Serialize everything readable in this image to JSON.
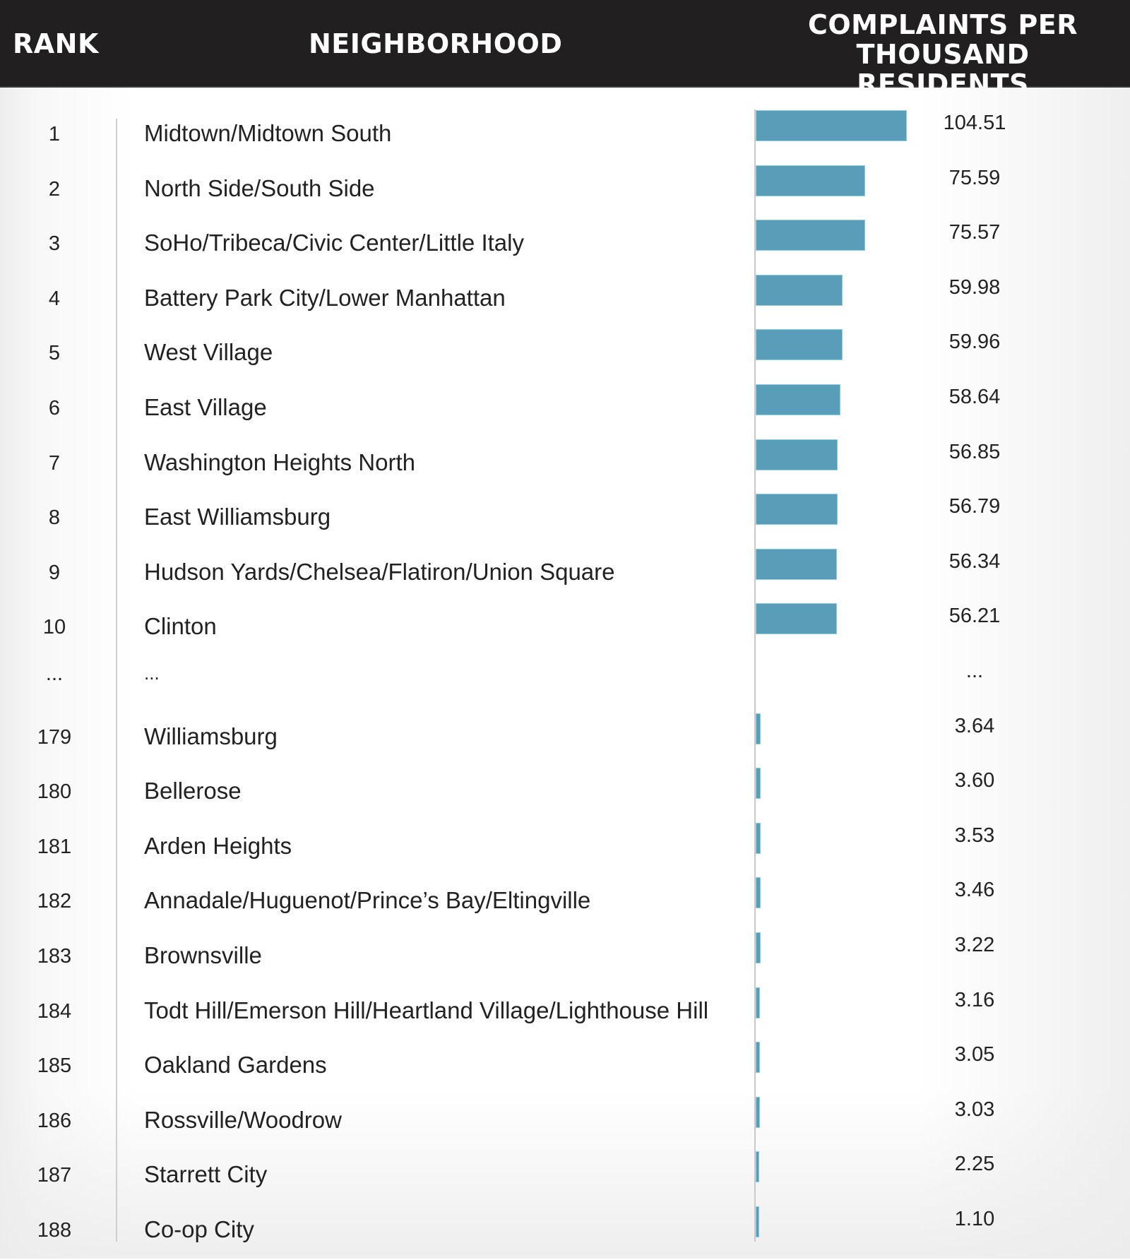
{
  "header": {
    "rank_label": "RANK",
    "neighborhood_label": "NEIGHBORHOOD",
    "metric_label_line1": "COMPLAINTS PER",
    "metric_label_line2": "THOUSAND RESIDENTS"
  },
  "colors": {
    "header_bg": "#221f20",
    "bar": "#5a9db9",
    "text": "#222222"
  },
  "chart_data": {
    "type": "bar",
    "orientation": "horizontal",
    "title": "",
    "xlabel": "Complaints per thousand residents",
    "ylabel": "Neighborhood",
    "xlim": [
      0,
      104.51
    ],
    "grid": false,
    "legend": "none",
    "rows": [
      {
        "rank": "1",
        "neighborhood": "Midtown/Midtown South",
        "value": 104.51,
        "label": "104.51"
      },
      {
        "rank": "2",
        "neighborhood": "North Side/South Side",
        "value": 75.59,
        "label": "75.59"
      },
      {
        "rank": "3",
        "neighborhood": "SoHo/Tribeca/Civic Center/Little Italy",
        "value": 75.57,
        "label": "75.57"
      },
      {
        "rank": "4",
        "neighborhood": "Battery Park City/Lower Manhattan",
        "value": 59.98,
        "label": "59.98"
      },
      {
        "rank": "5",
        "neighborhood": "West Village",
        "value": 59.96,
        "label": "59.96"
      },
      {
        "rank": "6",
        "neighborhood": "East Village",
        "value": 58.64,
        "label": "58.64"
      },
      {
        "rank": "7",
        "neighborhood": "Washington Heights North",
        "value": 56.85,
        "label": "56.85"
      },
      {
        "rank": "8",
        "neighborhood": "East Williamsburg",
        "value": 56.79,
        "label": "56.79"
      },
      {
        "rank": "9",
        "neighborhood": "Hudson Yards/Chelsea/Flatiron/Union Square",
        "value": 56.34,
        "label": "56.34"
      },
      {
        "rank": "10",
        "neighborhood": "Clinton",
        "value": 56.21,
        "label": "56.21"
      },
      {
        "rank": "...",
        "neighborhood": "...",
        "value": null,
        "label": "..."
      },
      {
        "rank": "179",
        "neighborhood": "Williamsburg",
        "value": 3.64,
        "label": "3.64"
      },
      {
        "rank": "180",
        "neighborhood": "Bellerose",
        "value": 3.6,
        "label": "3.60"
      },
      {
        "rank": "181",
        "neighborhood": "Arden Heights",
        "value": 3.53,
        "label": "3.53"
      },
      {
        "rank": "182",
        "neighborhood": "Annadale/Huguenot/Prince’s Bay/Eltingville",
        "value": 3.46,
        "label": "3.46"
      },
      {
        "rank": "183",
        "neighborhood": "Brownsville",
        "value": 3.22,
        "label": "3.22"
      },
      {
        "rank": "184",
        "neighborhood": "Todt Hill/Emerson Hill/Heartland Village/Lighthouse Hill",
        "value": 3.16,
        "label": "3.16"
      },
      {
        "rank": "185",
        "neighborhood": "Oakland Gardens",
        "value": 3.05,
        "label": "3.05"
      },
      {
        "rank": "186",
        "neighborhood": "Rossville/Woodrow",
        "value": 3.03,
        "label": "3.03"
      },
      {
        "rank": "187",
        "neighborhood": "Starrett City",
        "value": 2.25,
        "label": "2.25"
      },
      {
        "rank": "188",
        "neighborhood": "Co-op City",
        "value": 1.1,
        "label": "1.10"
      }
    ]
  }
}
